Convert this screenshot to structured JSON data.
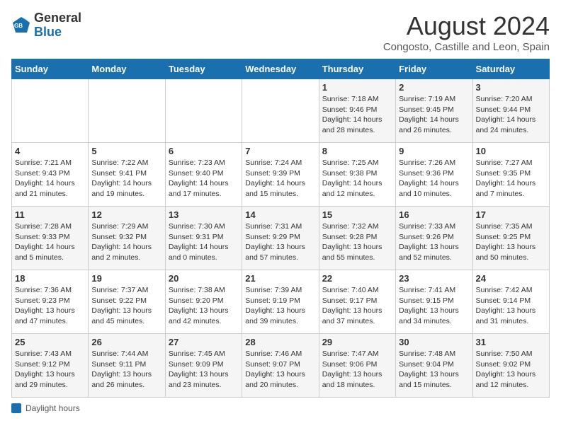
{
  "logo": {
    "general": "General",
    "blue": "Blue"
  },
  "title": "August 2024",
  "subtitle": "Congosto, Castille and Leon, Spain",
  "days_of_week": [
    "Sunday",
    "Monday",
    "Tuesday",
    "Wednesday",
    "Thursday",
    "Friday",
    "Saturday"
  ],
  "footer": {
    "label": "Daylight hours"
  },
  "weeks": [
    [
      {
        "num": "",
        "info": ""
      },
      {
        "num": "",
        "info": ""
      },
      {
        "num": "",
        "info": ""
      },
      {
        "num": "",
        "info": ""
      },
      {
        "num": "1",
        "info": "Sunrise: 7:18 AM\nSunset: 9:46 PM\nDaylight: 14 hours\nand 28 minutes."
      },
      {
        "num": "2",
        "info": "Sunrise: 7:19 AM\nSunset: 9:45 PM\nDaylight: 14 hours\nand 26 minutes."
      },
      {
        "num": "3",
        "info": "Sunrise: 7:20 AM\nSunset: 9:44 PM\nDaylight: 14 hours\nand 24 minutes."
      }
    ],
    [
      {
        "num": "4",
        "info": "Sunrise: 7:21 AM\nSunset: 9:43 PM\nDaylight: 14 hours\nand 21 minutes."
      },
      {
        "num": "5",
        "info": "Sunrise: 7:22 AM\nSunset: 9:41 PM\nDaylight: 14 hours\nand 19 minutes."
      },
      {
        "num": "6",
        "info": "Sunrise: 7:23 AM\nSunset: 9:40 PM\nDaylight: 14 hours\nand 17 minutes."
      },
      {
        "num": "7",
        "info": "Sunrise: 7:24 AM\nSunset: 9:39 PM\nDaylight: 14 hours\nand 15 minutes."
      },
      {
        "num": "8",
        "info": "Sunrise: 7:25 AM\nSunset: 9:38 PM\nDaylight: 14 hours\nand 12 minutes."
      },
      {
        "num": "9",
        "info": "Sunrise: 7:26 AM\nSunset: 9:36 PM\nDaylight: 14 hours\nand 10 minutes."
      },
      {
        "num": "10",
        "info": "Sunrise: 7:27 AM\nSunset: 9:35 PM\nDaylight: 14 hours\nand 7 minutes."
      }
    ],
    [
      {
        "num": "11",
        "info": "Sunrise: 7:28 AM\nSunset: 9:33 PM\nDaylight: 14 hours\nand 5 minutes."
      },
      {
        "num": "12",
        "info": "Sunrise: 7:29 AM\nSunset: 9:32 PM\nDaylight: 14 hours\nand 2 minutes."
      },
      {
        "num": "13",
        "info": "Sunrise: 7:30 AM\nSunset: 9:31 PM\nDaylight: 14 hours\nand 0 minutes."
      },
      {
        "num": "14",
        "info": "Sunrise: 7:31 AM\nSunset: 9:29 PM\nDaylight: 13 hours\nand 57 minutes."
      },
      {
        "num": "15",
        "info": "Sunrise: 7:32 AM\nSunset: 9:28 PM\nDaylight: 13 hours\nand 55 minutes."
      },
      {
        "num": "16",
        "info": "Sunrise: 7:33 AM\nSunset: 9:26 PM\nDaylight: 13 hours\nand 52 minutes."
      },
      {
        "num": "17",
        "info": "Sunrise: 7:35 AM\nSunset: 9:25 PM\nDaylight: 13 hours\nand 50 minutes."
      }
    ],
    [
      {
        "num": "18",
        "info": "Sunrise: 7:36 AM\nSunset: 9:23 PM\nDaylight: 13 hours\nand 47 minutes."
      },
      {
        "num": "19",
        "info": "Sunrise: 7:37 AM\nSunset: 9:22 PM\nDaylight: 13 hours\nand 45 minutes."
      },
      {
        "num": "20",
        "info": "Sunrise: 7:38 AM\nSunset: 9:20 PM\nDaylight: 13 hours\nand 42 minutes."
      },
      {
        "num": "21",
        "info": "Sunrise: 7:39 AM\nSunset: 9:19 PM\nDaylight: 13 hours\nand 39 minutes."
      },
      {
        "num": "22",
        "info": "Sunrise: 7:40 AM\nSunset: 9:17 PM\nDaylight: 13 hours\nand 37 minutes."
      },
      {
        "num": "23",
        "info": "Sunrise: 7:41 AM\nSunset: 9:15 PM\nDaylight: 13 hours\nand 34 minutes."
      },
      {
        "num": "24",
        "info": "Sunrise: 7:42 AM\nSunset: 9:14 PM\nDaylight: 13 hours\nand 31 minutes."
      }
    ],
    [
      {
        "num": "25",
        "info": "Sunrise: 7:43 AM\nSunset: 9:12 PM\nDaylight: 13 hours\nand 29 minutes."
      },
      {
        "num": "26",
        "info": "Sunrise: 7:44 AM\nSunset: 9:11 PM\nDaylight: 13 hours\nand 26 minutes."
      },
      {
        "num": "27",
        "info": "Sunrise: 7:45 AM\nSunset: 9:09 PM\nDaylight: 13 hours\nand 23 minutes."
      },
      {
        "num": "28",
        "info": "Sunrise: 7:46 AM\nSunset: 9:07 PM\nDaylight: 13 hours\nand 20 minutes."
      },
      {
        "num": "29",
        "info": "Sunrise: 7:47 AM\nSunset: 9:06 PM\nDaylight: 13 hours\nand 18 minutes."
      },
      {
        "num": "30",
        "info": "Sunrise: 7:48 AM\nSunset: 9:04 PM\nDaylight: 13 hours\nand 15 minutes."
      },
      {
        "num": "31",
        "info": "Sunrise: 7:50 AM\nSunset: 9:02 PM\nDaylight: 13 hours\nand 12 minutes."
      }
    ]
  ]
}
